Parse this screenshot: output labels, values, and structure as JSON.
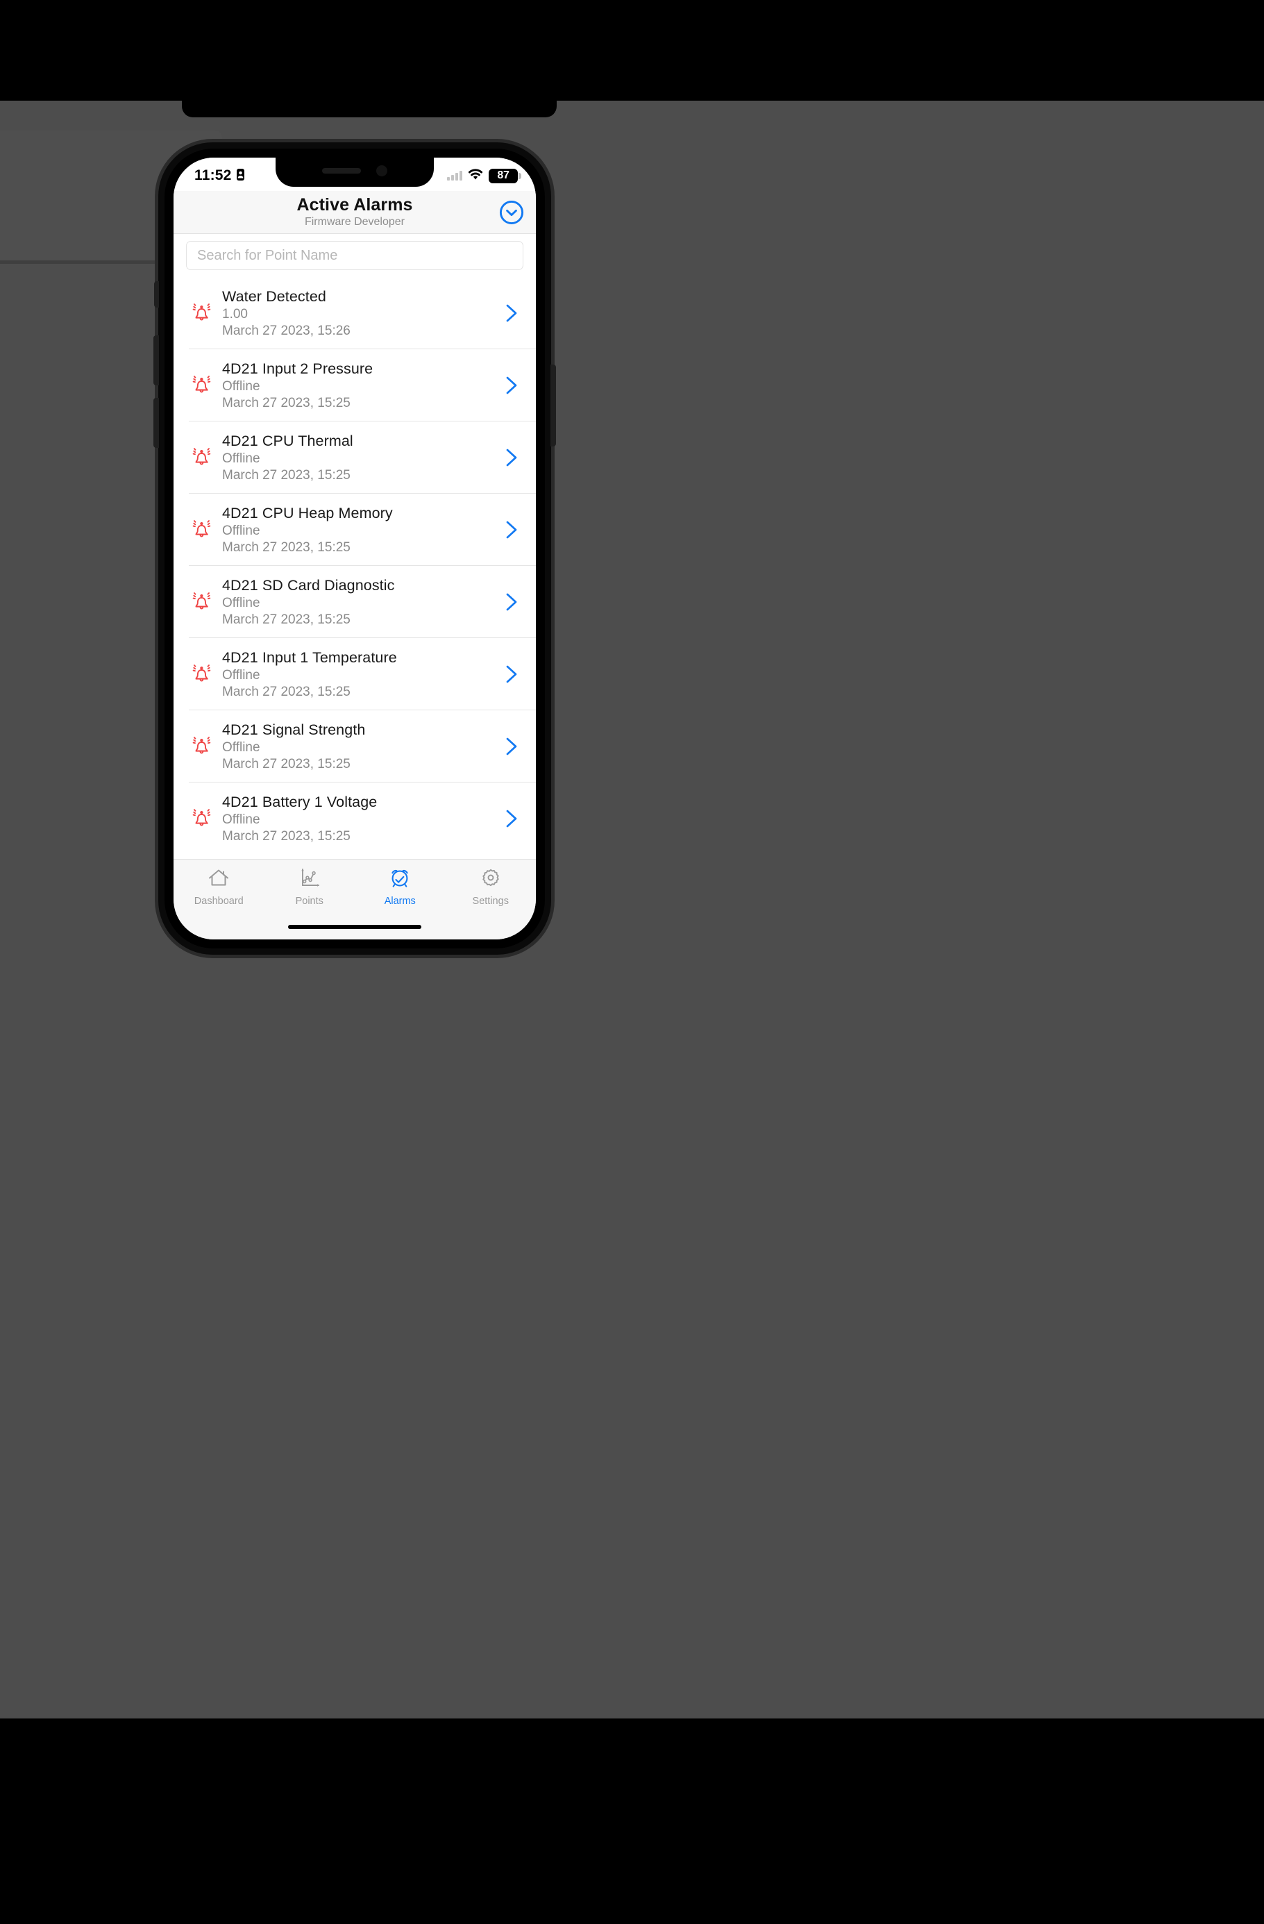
{
  "theme": {
    "accent_blue": "#1279f2",
    "alarm_red": "#ef4444",
    "backdrop_gray": "#4d4d4d",
    "muted_text": "#8a8a8a"
  },
  "status_bar": {
    "time": "11:52",
    "location_icon": "location-arrow-icon",
    "cellular_icon": "cellular-bars-icon",
    "wifi_icon": "wifi-icon",
    "battery_level": "87",
    "battery_icon": "battery-icon"
  },
  "nav": {
    "title": "Active Alarms",
    "subtitle": "Firmware Developer",
    "action_icon": "chevron-down-circle-icon"
  },
  "search": {
    "placeholder": "Search for Point Name",
    "value": ""
  },
  "alarms": [
    {
      "icon": "alarm-bell-icon",
      "title": "Water Detected",
      "value": "1.00",
      "timestamp": "March 27 2023, 15:26",
      "chevron": "chevron-right-icon"
    },
    {
      "icon": "alarm-bell-icon",
      "title": "4D21 Input 2 Pressure",
      "value": "Offline",
      "timestamp": "March 27 2023, 15:25",
      "chevron": "chevron-right-icon"
    },
    {
      "icon": "alarm-bell-icon",
      "title": "4D21 CPU Thermal",
      "value": "Offline",
      "timestamp": "March 27 2023, 15:25",
      "chevron": "chevron-right-icon"
    },
    {
      "icon": "alarm-bell-icon",
      "title": "4D21 CPU Heap Memory",
      "value": "Offline",
      "timestamp": "March 27 2023, 15:25",
      "chevron": "chevron-right-icon"
    },
    {
      "icon": "alarm-bell-icon",
      "title": "4D21 SD Card Diagnostic",
      "value": "Offline",
      "timestamp": "March 27 2023, 15:25",
      "chevron": "chevron-right-icon"
    },
    {
      "icon": "alarm-bell-icon",
      "title": "4D21 Input 1 Temperature",
      "value": "Offline",
      "timestamp": "March 27 2023, 15:25",
      "chevron": "chevron-right-icon"
    },
    {
      "icon": "alarm-bell-icon",
      "title": "4D21 Signal Strength",
      "value": "Offline",
      "timestamp": "March 27 2023, 15:25",
      "chevron": "chevron-right-icon"
    },
    {
      "icon": "alarm-bell-icon",
      "title": "4D21 Battery 1 Voltage",
      "value": "Offline",
      "timestamp": "March 27 2023, 15:25",
      "chevron": "chevron-right-icon"
    }
  ],
  "tabs": [
    {
      "label": "Dashboard",
      "icon": "home-icon",
      "active": false
    },
    {
      "label": "Points",
      "icon": "line-chart-icon",
      "active": false
    },
    {
      "label": "Alarms",
      "icon": "alarm-clock-check-icon",
      "active": true
    },
    {
      "label": "Settings",
      "icon": "gear-icon",
      "active": false
    }
  ]
}
